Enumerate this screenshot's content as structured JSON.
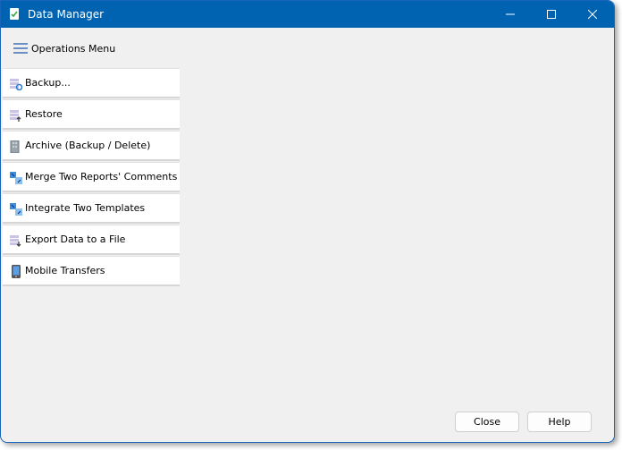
{
  "window": {
    "title": "Data Manager",
    "controls": {
      "minimize": "minimize",
      "maximize": "maximize",
      "close": "close"
    }
  },
  "operations_menu": {
    "label": "Operations Menu",
    "icon": "hamburger-icon"
  },
  "items": [
    {
      "label": "Backup...",
      "icon": "backup-icon"
    },
    {
      "label": "Restore",
      "icon": "restore-icon"
    },
    {
      "label": "Archive (Backup / Delete)",
      "icon": "archive-icon"
    },
    {
      "label": "Merge Two Reports' Comments",
      "icon": "merge-icon"
    },
    {
      "label": "Integrate Two Templates",
      "icon": "integrate-icon"
    },
    {
      "label": "Export Data to a File",
      "icon": "export-icon"
    },
    {
      "label": "Mobile Transfers",
      "icon": "mobile-icon"
    }
  ],
  "footer": {
    "close_label": "Close",
    "help_label": "Help"
  },
  "colors": {
    "titlebar": "#0063b1",
    "accent": "#1764b8"
  }
}
